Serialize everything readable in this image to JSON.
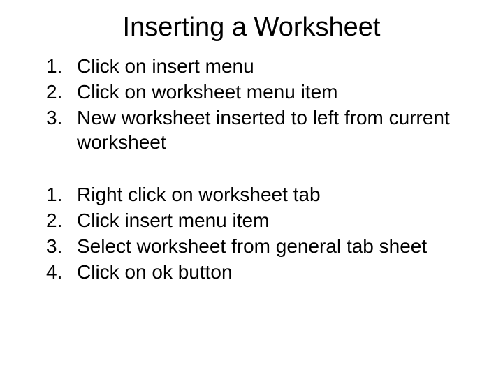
{
  "title": "Inserting a Worksheet",
  "list1": [
    "Click on insert menu",
    "Click on worksheet menu item",
    "New worksheet inserted to left from current worksheet"
  ],
  "list2": [
    "Right click on worksheet tab",
    "Click insert menu item",
    "Select worksheet from general tab sheet",
    "Click on ok button"
  ]
}
